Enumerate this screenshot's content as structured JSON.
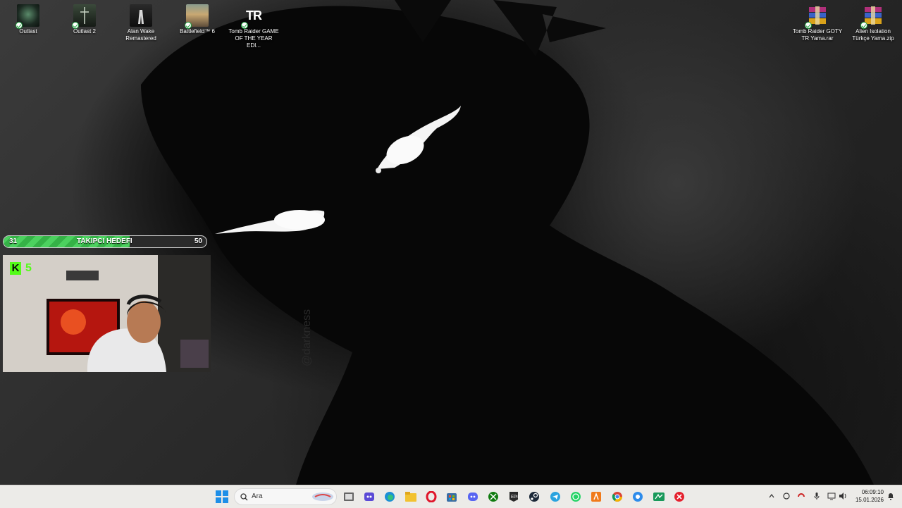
{
  "desktop": {
    "icons_left": [
      {
        "label": "Outlast"
      },
      {
        "label": "Outlast 2"
      },
      {
        "label": "Alan Wake Remastered"
      },
      {
        "label": "Battlefield™ 6"
      },
      {
        "label": "Tomb Raider GAME OF THE YEAR EDI..."
      }
    ],
    "icons_right": [
      {
        "label": "Tomb Raider GOTY TR Yama.rar"
      },
      {
        "label": "Alien Isolation Türkçe Yama.zip"
      }
    ],
    "tr_logo_text": "TR"
  },
  "overlay": {
    "follower_goal": {
      "current": "31",
      "label": "TAKIPCI HEDEFI",
      "target": "50",
      "progress": 0.62,
      "color": "#4cd15f"
    },
    "kick_badge": {
      "letter": "K",
      "count": "5",
      "color": "#53fc18"
    }
  },
  "taskbar": {
    "search_placeholder": "Ara",
    "app_icons": [
      "start-icon",
      "task-view-icon",
      "copilot-icon",
      "edge-icon",
      "file-explorer-icon",
      "opera-icon",
      "store-icon",
      "discord-icon",
      "xbox-icon",
      "epic-games-icon",
      "steam-icon",
      "telegram-icon",
      "whatsapp-icon",
      "app-orange-icon",
      "chrome-icon",
      "app-blue-icon",
      "app-green-icon",
      "app-red-icon"
    ],
    "tray_icons": [
      "chevron-up-icon",
      "tray-app-icon",
      "tray-app2-icon",
      "microphone-icon",
      "network-icon",
      "volume-icon"
    ],
    "clock": {
      "time": "06:09:10",
      "date": "15.01.2026"
    },
    "notification_icon": "notification-icon"
  }
}
